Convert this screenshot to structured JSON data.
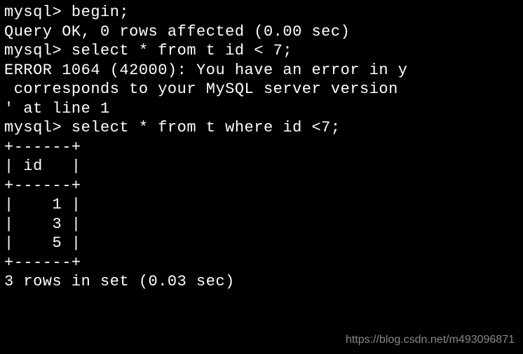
{
  "terminal": {
    "lines": [
      "mysql> begin;",
      "Query OK, 0 rows affected (0.00 sec)",
      "",
      "mysql> select * from t id < 7;",
      "ERROR 1064 (42000): You have an error in y",
      " corresponds to your MySQL server version ",
      "' at line 1",
      "mysql> select * from t where id <7;",
      "+------+",
      "| id   |",
      "+------+",
      "|    1 |",
      "|    3 |",
      "|    5 |",
      "+------+",
      "3 rows in set (0.03 sec)"
    ]
  },
  "watermark": "https://blog.csdn.net/m493096871"
}
